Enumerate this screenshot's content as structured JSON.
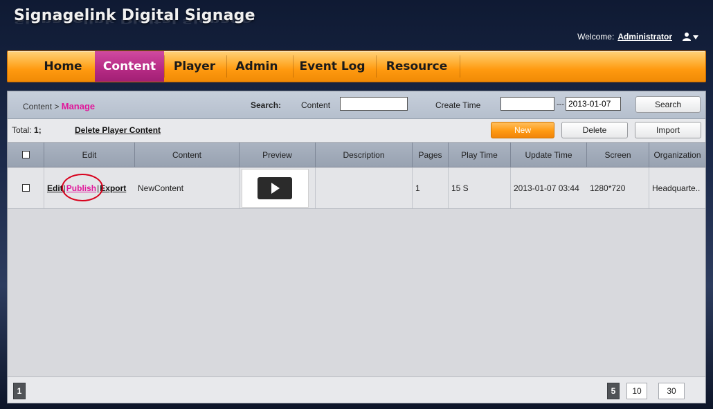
{
  "app": {
    "title": "Signagelink Digital Signage"
  },
  "header": {
    "welcome_label": "Welcome:",
    "user": "Administrator"
  },
  "nav": {
    "items": [
      {
        "label": "Home"
      },
      {
        "label": "Content",
        "active": true
      },
      {
        "label": "Player"
      },
      {
        "label": "Admin"
      },
      {
        "label": "Event Log"
      },
      {
        "label": "Resource"
      }
    ]
  },
  "breadcrumb": {
    "parent": "Content",
    "sep": ">",
    "current": "Manage"
  },
  "search": {
    "label": "Search:",
    "content_label": "Content",
    "content_value": "",
    "create_time_label": "Create Time",
    "from_value": "",
    "range_sep": "---",
    "to_value": "2013-01-07",
    "button": "Search"
  },
  "toolbar": {
    "total_label": "Total:",
    "total_value": "1;",
    "delete_player_content": "Delete Player Content",
    "new": "New",
    "delete": "Delete",
    "import": "Import"
  },
  "table": {
    "columns": [
      "Edit",
      "Content",
      "Preview",
      "Description",
      "Pages",
      "Play Time",
      "Update Time",
      "Screen",
      "Organization"
    ],
    "rows": [
      {
        "actions": {
          "edit": "Edit",
          "sep1": "|",
          "publish": "Publish",
          "sep2": "|",
          "export": "Export"
        },
        "content": "NewContent",
        "description": "",
        "pages": "1",
        "play_time": "15 S",
        "update_time": "2013-01-07 03:44",
        "screen": "1280*720",
        "organization": "Headquarte.."
      }
    ]
  },
  "pager": {
    "current_page": "1",
    "sizes": [
      "5",
      "10",
      "30"
    ],
    "active_size": "5"
  },
  "colors": {
    "accent_pink": "#e0179a",
    "nav_orange": "#ff9a10",
    "highlight_circle": "#d8001c"
  },
  "icons": {
    "user_menu": "user-dropdown-icon",
    "preview": "play-icon"
  }
}
